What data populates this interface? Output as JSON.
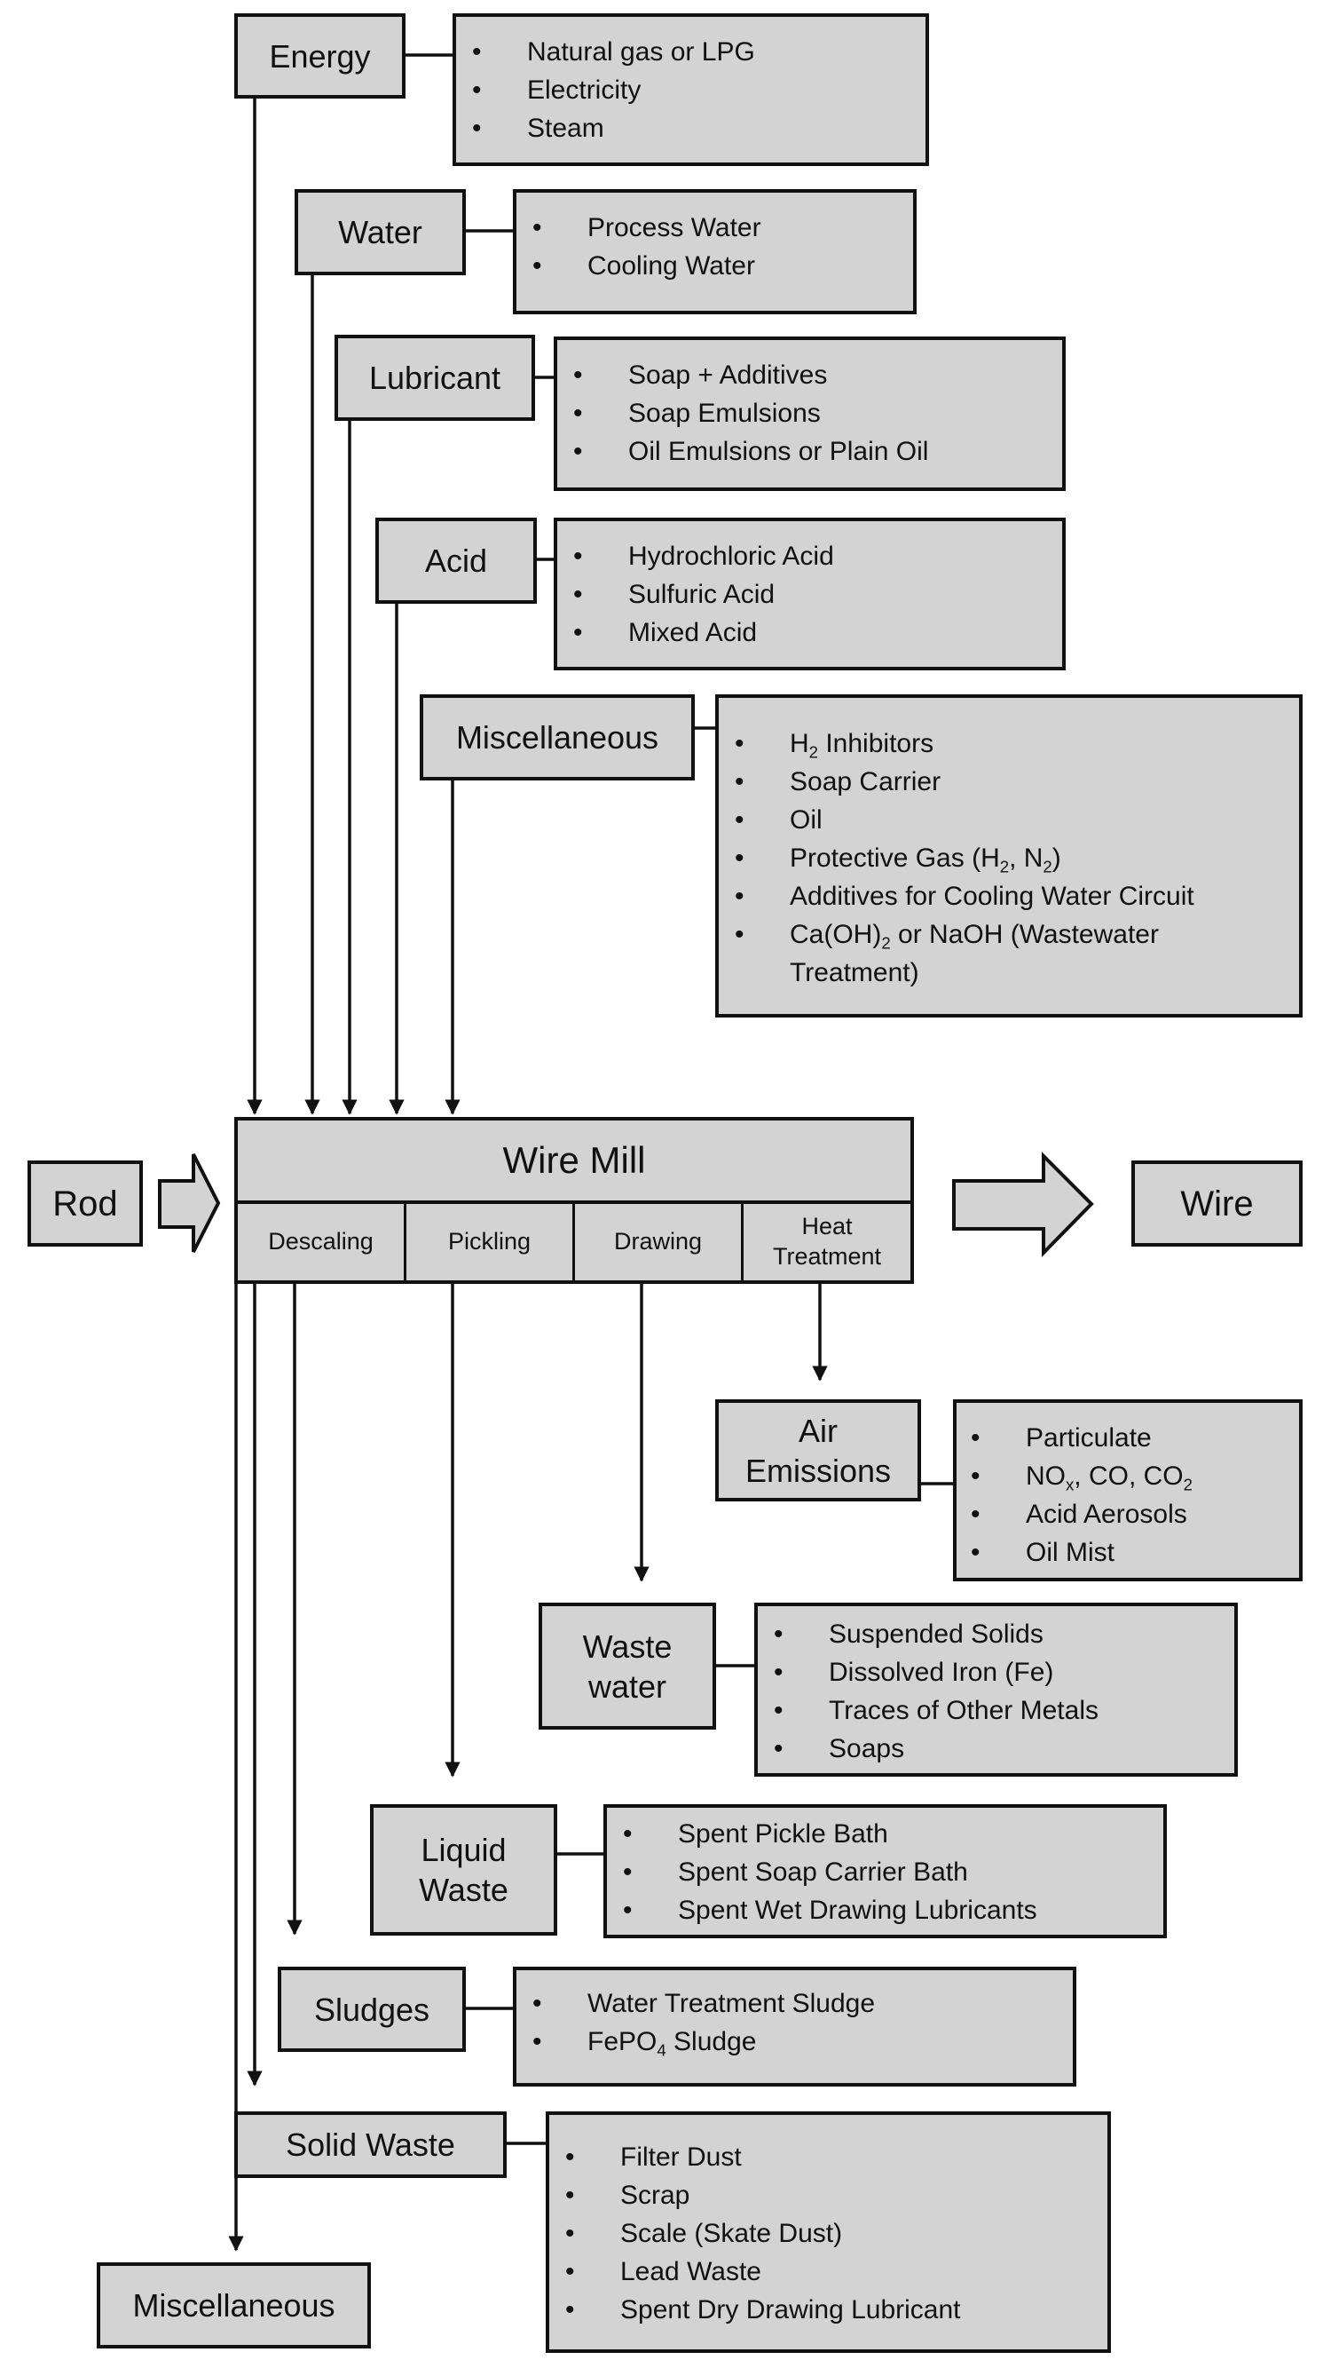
{
  "inputs": [
    {
      "label": "Energy",
      "items": [
        [
          "Natural gas or LPG"
        ],
        [
          "Electricity"
        ],
        [
          "Steam"
        ]
      ]
    },
    {
      "label": "Water",
      "items": [
        [
          "Process Water"
        ],
        [
          "Cooling Water"
        ]
      ]
    },
    {
      "label": "Lubricant",
      "items": [
        [
          "Soap + Additives"
        ],
        [
          "Soap Emulsions"
        ],
        [
          "Oil Emulsions or Plain Oil"
        ]
      ]
    },
    {
      "label": "Acid",
      "items": [
        [
          "Hydrochloric Acid"
        ],
        [
          "Sulfuric Acid"
        ],
        [
          "Mixed Acid"
        ]
      ]
    },
    {
      "label": "Miscellaneous",
      "items": [
        [
          "H",
          {
            "sub": "2"
          },
          " Inhibitors"
        ],
        [
          "Soap Carrier"
        ],
        [
          "Oil"
        ],
        [
          "Protective Gas (H",
          {
            "sub": "2"
          },
          ", N",
          {
            "sub": "2"
          },
          ")"
        ],
        [
          "Additives for Cooling Water Circuit"
        ],
        [
          "Ca(OH)",
          {
            "sub": "2"
          },
          " or NaOH (Wastewater Treatment)"
        ]
      ]
    }
  ],
  "process": {
    "input_material": "Rod",
    "title": "Wire Mill",
    "steps": [
      "Descaling",
      "Pickling",
      "Drawing",
      "Heat Treatment"
    ],
    "output_material": "Wire"
  },
  "outputs": [
    {
      "label": "Air Emissions",
      "items": [
        [
          "Particulate"
        ],
        [
          "NO",
          {
            "sub": "x"
          },
          ", CO, CO",
          {
            "sub": "2"
          }
        ],
        [
          "Acid Aerosols"
        ],
        [
          "Oil Mist"
        ]
      ]
    },
    {
      "label": "Waste water",
      "items": [
        [
          "Suspended Solids"
        ],
        [
          "Dissolved Iron (Fe)"
        ],
        [
          "Traces of Other Metals"
        ],
        [
          "Soaps"
        ]
      ]
    },
    {
      "label": "Liquid Waste",
      "items": [
        [
          "Spent Pickle Bath"
        ],
        [
          "Spent Soap Carrier Bath"
        ],
        [
          "Spent Wet Drawing Lubricants"
        ]
      ]
    },
    {
      "label": "Sludges",
      "items": [
        [
          "Water Treatment Sludge"
        ],
        [
          "FePO",
          {
            "sub": "4"
          },
          " Sludge"
        ]
      ]
    },
    {
      "label": "Solid Waste",
      "items": [
        [
          "Filter Dust"
        ],
        [
          "Scrap"
        ],
        [
          "Scale (Skate Dust)"
        ],
        [
          "Lead Waste"
        ],
        [
          "Spent Dry Drawing Lubricant"
        ]
      ]
    },
    {
      "label": "Miscellaneous",
      "items": []
    }
  ],
  "colors": {
    "box_fill": "#d3d3d3",
    "stroke": "#111111",
    "background": "#ffffff"
  }
}
